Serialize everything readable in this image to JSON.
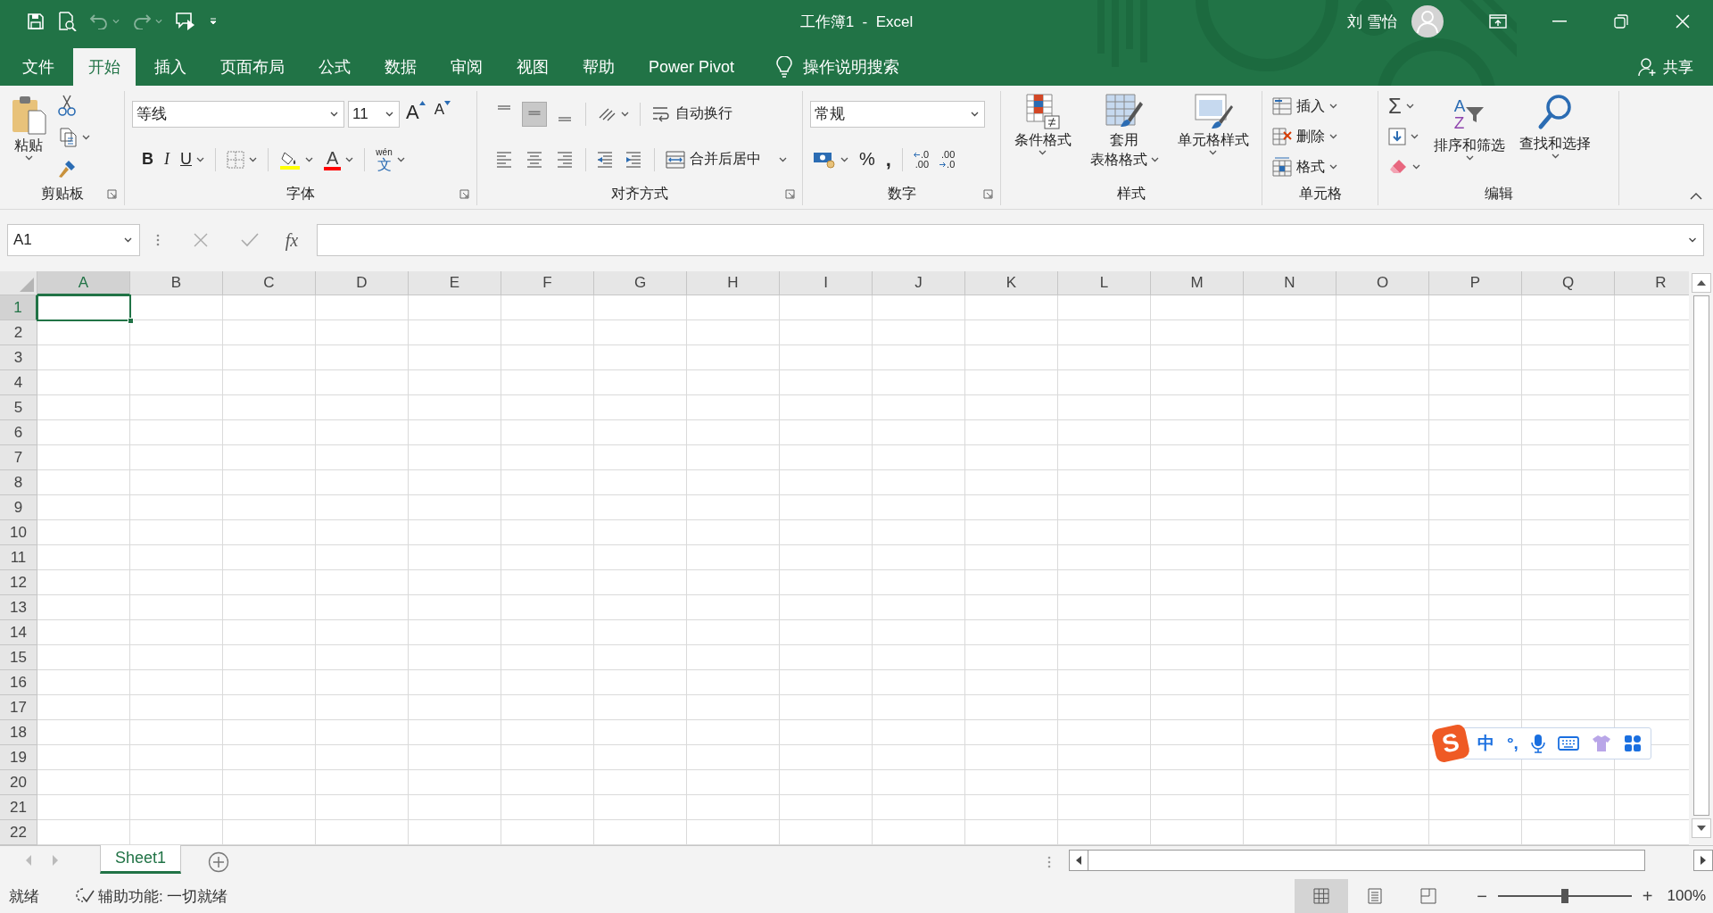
{
  "title_bar": {
    "title": "工作簿1  -  Excel",
    "user": "刘 雪怡",
    "undo": {
      "disabled": true
    },
    "redo": {
      "disabled": true
    }
  },
  "ribbon_tabs": [
    {
      "label": "文件",
      "selected": false
    },
    {
      "label": "开始",
      "selected": true
    },
    {
      "label": "插入",
      "selected": false
    },
    {
      "label": "页面布局",
      "selected": false
    },
    {
      "label": "公式",
      "selected": false
    },
    {
      "label": "数据",
      "selected": false
    },
    {
      "label": "审阅",
      "selected": false
    },
    {
      "label": "视图",
      "selected": false
    },
    {
      "label": "帮助",
      "selected": false
    },
    {
      "label": "Power Pivot",
      "selected": false
    }
  ],
  "tell_me": {
    "placeholder": "操作说明搜索"
  },
  "share": "共享",
  "clipboard": {
    "paste": "粘贴",
    "label": "剪贴板"
  },
  "font": {
    "name": "等线",
    "size": "11",
    "grow": "A",
    "shrink": "A",
    "bold": "B",
    "italic": "I",
    "underline": "U",
    "font_color": "A",
    "phonetic_top": "wén",
    "phonetic_bottom": "文",
    "label": "字体"
  },
  "alignment": {
    "vertical_align": [
      {
        "selected": false
      },
      {
        "selected": true
      },
      {
        "selected": false
      }
    ],
    "wrap_text": "自动换行",
    "merge_center": "合并后居中",
    "label": "对齐方式"
  },
  "number": {
    "format": "常规",
    "percent": "%",
    "comma": ",",
    "decimal_buttons": [
      {
        "top": ".0",
        "bottom": ".00"
      },
      {
        "top": ".00",
        "bottom": ".0"
      }
    ],
    "label": "数字"
  },
  "styles": {
    "conditional": "条件格式",
    "table_lines": [
      "套用",
      "表格格式"
    ],
    "cell_styles": "单元格样式",
    "label": "样式"
  },
  "cells": {
    "items": [
      "插入",
      "删除",
      "格式"
    ],
    "label": "单元格"
  },
  "editing": {
    "sum": "Σ",
    "sort_letters": [
      "A",
      "Z"
    ],
    "sort_filter": "排序和筛选",
    "find_select": "查找和选择",
    "label": "编辑"
  },
  "formula_bar": {
    "name_box": "A1",
    "fx": "fx"
  },
  "columns": [
    {
      "label": "A",
      "selected": true
    },
    {
      "label": "B",
      "selected": false
    },
    {
      "label": "C",
      "selected": false
    },
    {
      "label": "D",
      "selected": false
    },
    {
      "label": "E",
      "selected": false
    },
    {
      "label": "F",
      "selected": false
    },
    {
      "label": "G",
      "selected": false
    },
    {
      "label": "H",
      "selected": false
    },
    {
      "label": "I",
      "selected": false
    },
    {
      "label": "J",
      "selected": false
    },
    {
      "label": "K",
      "selected": false
    },
    {
      "label": "L",
      "selected": false
    },
    {
      "label": "M",
      "selected": false
    },
    {
      "label": "N",
      "selected": false
    },
    {
      "label": "O",
      "selected": false
    },
    {
      "label": "P",
      "selected": false
    },
    {
      "label": "Q",
      "selected": false
    },
    {
      "label": "R",
      "selected": false
    }
  ],
  "rows": [
    {
      "label": "1",
      "selected": true
    },
    {
      "label": "2",
      "selected": false
    },
    {
      "label": "3",
      "selected": false
    },
    {
      "label": "4",
      "selected": false
    },
    {
      "label": "5",
      "selected": false
    },
    {
      "label": "6",
      "selected": false
    },
    {
      "label": "7",
      "selected": false
    },
    {
      "label": "8",
      "selected": false
    },
    {
      "label": "9",
      "selected": false
    },
    {
      "label": "10",
      "selected": false
    },
    {
      "label": "11",
      "selected": false
    },
    {
      "label": "12",
      "selected": false
    },
    {
      "label": "13",
      "selected": false
    },
    {
      "label": "14",
      "selected": false
    },
    {
      "label": "15",
      "selected": false
    },
    {
      "label": "16",
      "selected": false
    },
    {
      "label": "17",
      "selected": false
    },
    {
      "label": "18",
      "selected": false
    },
    {
      "label": "19",
      "selected": false
    },
    {
      "label": "20",
      "selected": false
    },
    {
      "label": "21",
      "selected": false
    },
    {
      "label": "22",
      "selected": false
    }
  ],
  "sheet_tabs": [
    {
      "label": "Sheet1",
      "selected": true
    }
  ],
  "status_bar": {
    "ready": "就绪",
    "accessibility": "辅助功能: 一切就绪",
    "views": [
      {
        "selected": true
      },
      {
        "selected": false
      },
      {
        "selected": false
      }
    ],
    "zoom_out": "−",
    "zoom_in": "+",
    "zoom": {
      "level": 0.5,
      "reading": "100%"
    }
  },
  "ime_toolbar": {
    "logo": "S",
    "mode": "中",
    "punctuation": "°,"
  }
}
